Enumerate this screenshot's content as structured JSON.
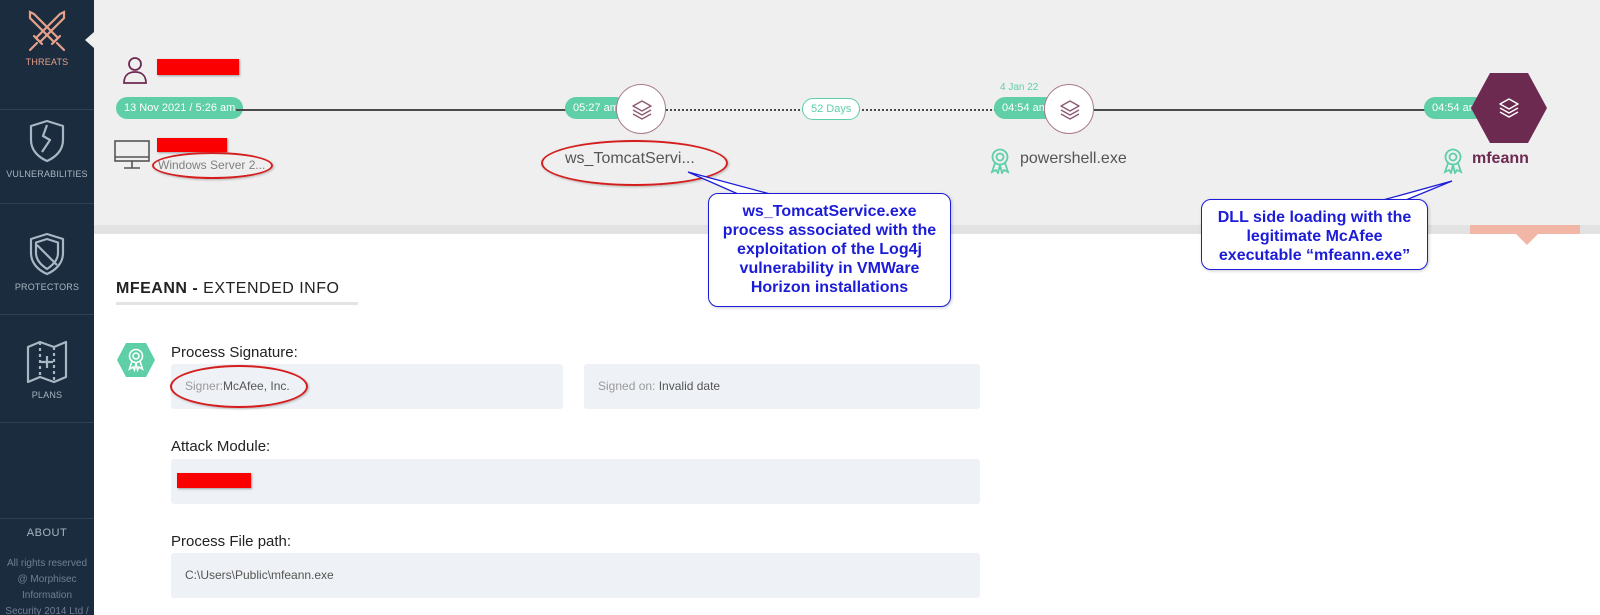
{
  "sidebar": {
    "items": [
      {
        "label": "THREATS",
        "icon": "crossed-swords-icon",
        "active": true
      },
      {
        "label": "VULNERABILITIES",
        "icon": "cracked-shield-icon",
        "active": false
      },
      {
        "label": "PROTECTORS",
        "icon": "shield-icon",
        "active": false
      },
      {
        "label": "PLANS",
        "icon": "map-icon",
        "active": false
      }
    ],
    "about": "ABOUT",
    "rights": [
      "All rights reserved",
      "@ Morphisec",
      "Information",
      "Security 2014 Ltd /"
    ]
  },
  "timeline": {
    "start_time": "13 Nov 2021 / 5:26 am",
    "host_os": "Windows Server 2...",
    "nodes": [
      {
        "time": "05:27 am",
        "label": "ws_TomcatServi...",
        "icon": "layers-icon"
      },
      {
        "date": "4 Jan 22",
        "time": "04:54 am",
        "label": "powershell.exe",
        "icon": "layers-icon"
      },
      {
        "time": "04:54 am",
        "label": "mfeann",
        "icon": "layers-icon",
        "selected": true
      }
    ],
    "gap": "52 Days"
  },
  "callouts": {
    "tomcat": "ws_TomcatService.exe process associated with the exploitation of the Log4j vulnerability in VMWare Horizon installations",
    "mfeann": "DLL side loading with the legitimate McAfee executable “mfeann.exe”"
  },
  "details": {
    "title_bold": "MFEANN -",
    "title_rest": " EXTENDED INFO",
    "signature_label": "Process Signature:",
    "signer_prefix": "Signer:",
    "signer_value": "McAfee, Inc.",
    "signed_on_prefix": "Signed on: ",
    "signed_on_value": "Invalid date",
    "attack_module_label": "Attack Module:",
    "file_path_label": "Process File path:",
    "file_path_value": "C:\\Users\\Public\\mfeann.exe"
  },
  "colors": {
    "sidebar": "#1a2c3d",
    "accent_green": "#5ecfa7",
    "accent_purple": "#6d2a50",
    "annotation_blue": "#1c1cd8",
    "annotation_red": "#d51d1d"
  }
}
